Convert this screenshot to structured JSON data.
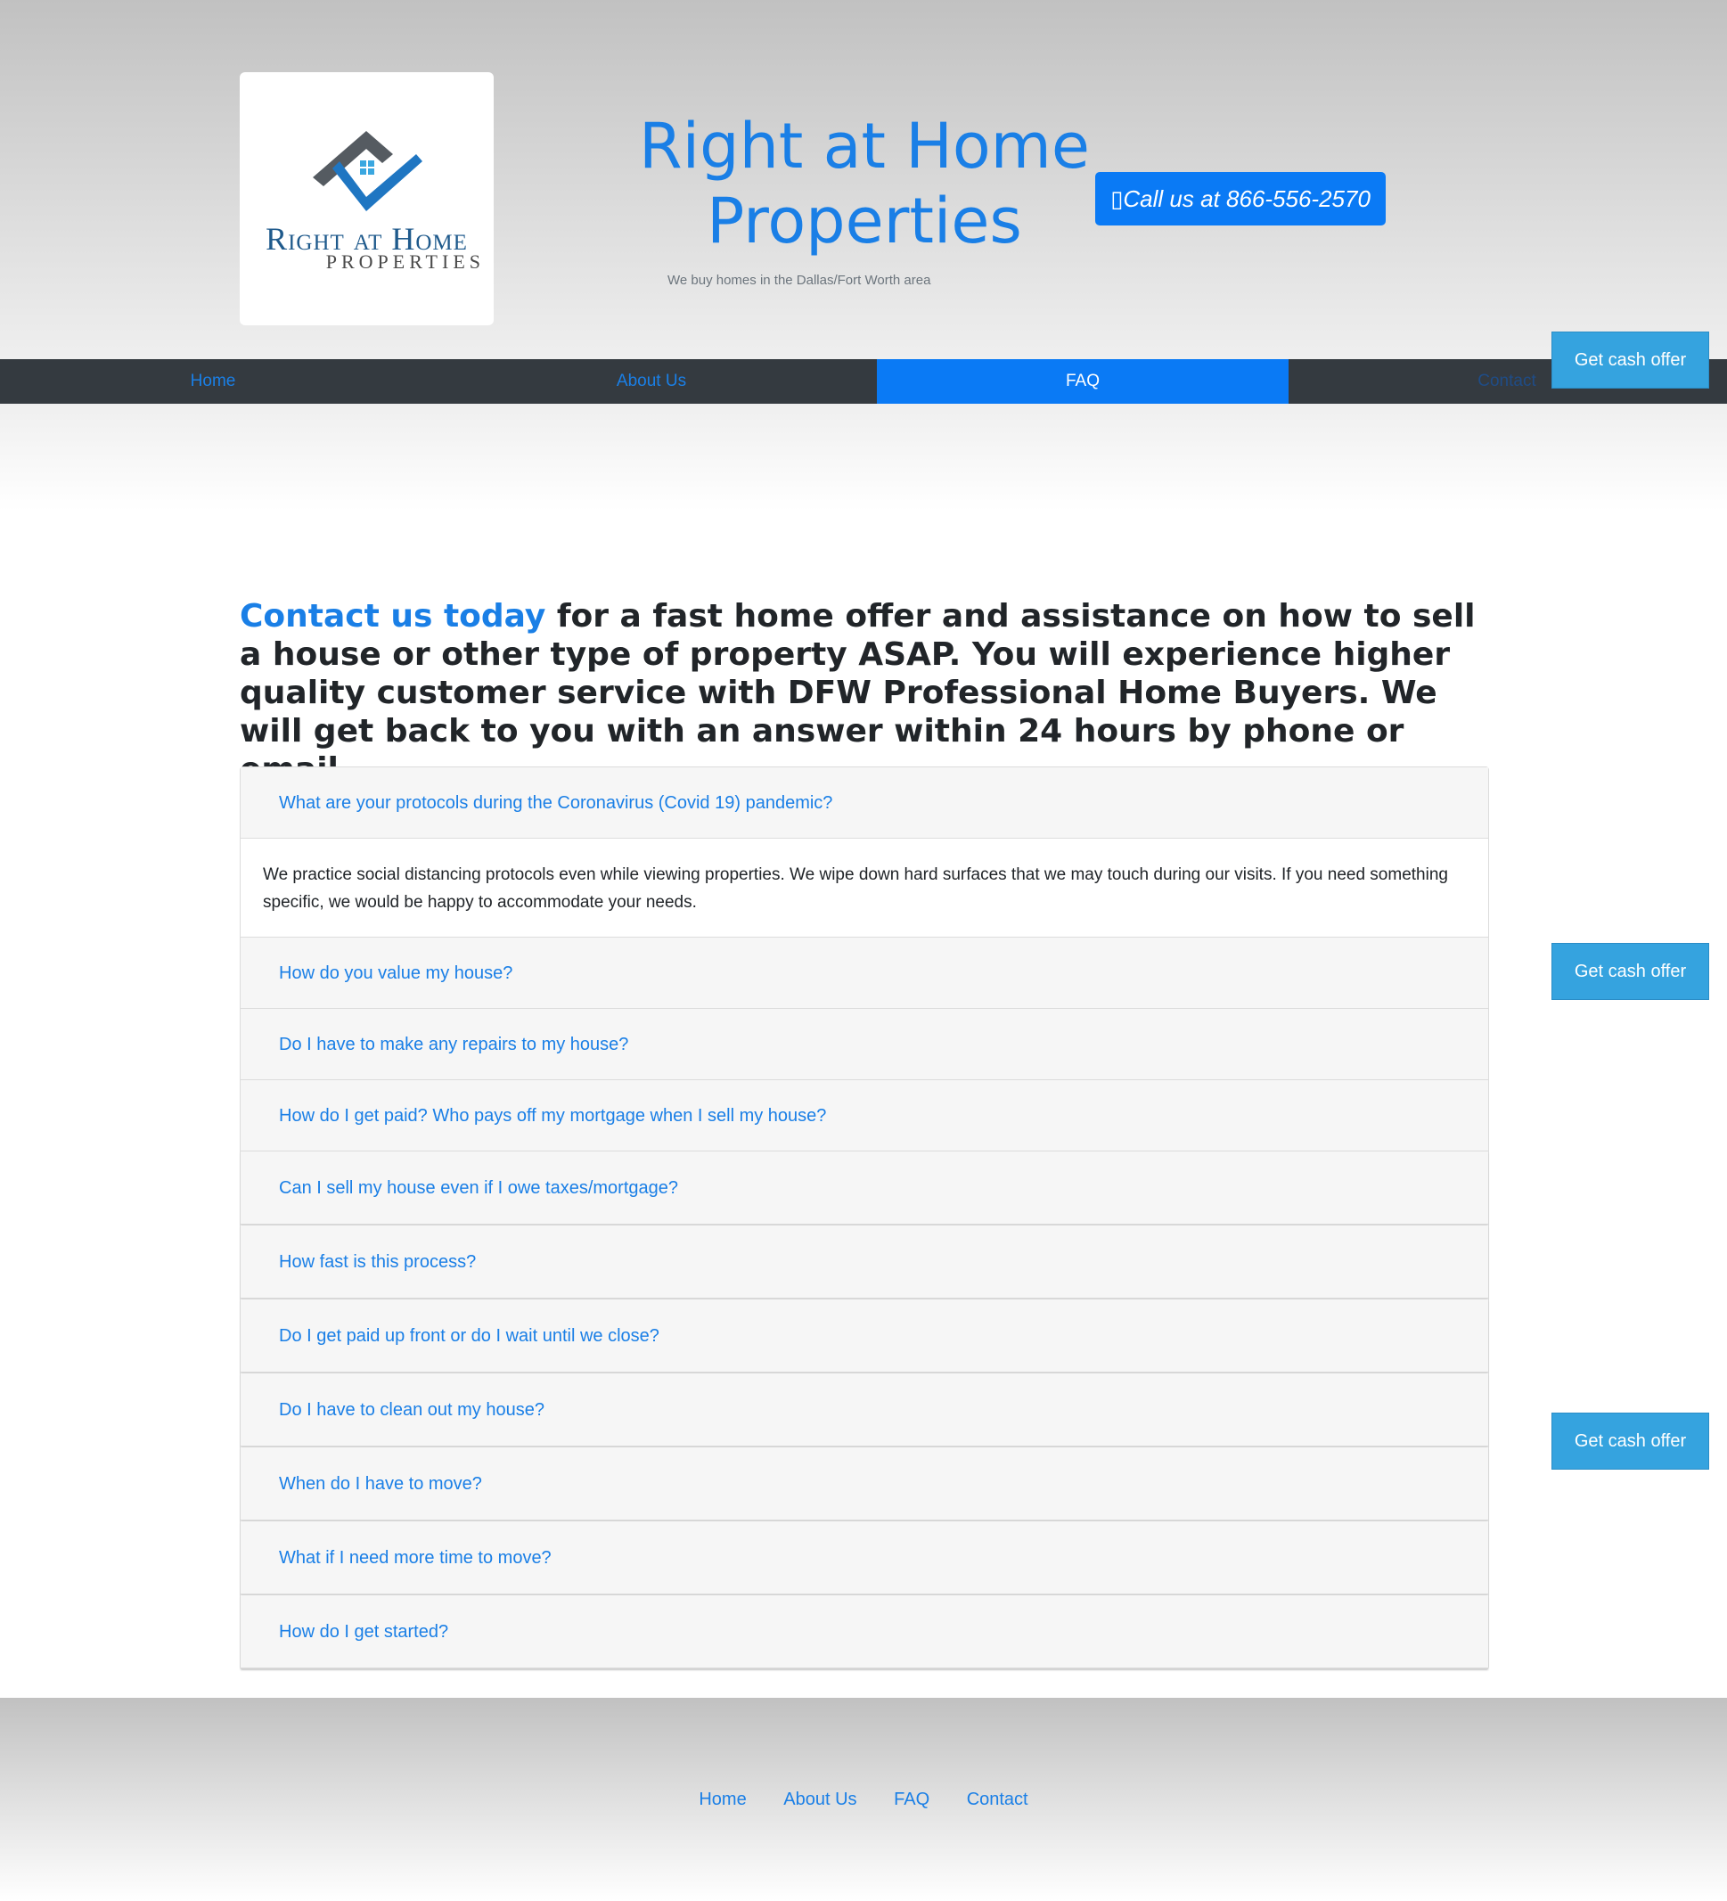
{
  "brand": {
    "logo_line1": "Right at Home",
    "logo_line2": "PROPERTIES",
    "title": "Right at Home Properties",
    "tagline": "We buy homes in the Dallas/Fort Worth area",
    "call_label": "▯Call us at 866-556-2570"
  },
  "nav": {
    "items": [
      {
        "label": "Home"
      },
      {
        "label": "About Us"
      },
      {
        "label": "FAQ",
        "active": true
      },
      {
        "label": "Contact"
      }
    ]
  },
  "cta": {
    "cash_offer": "Get cash offer"
  },
  "intro": {
    "highlight": "Contact us today",
    "text": " for a fast home offer and assistance on how to sell a house or other type of property ASAP. You will experience higher quality customer service with DFW Professional Home Buyers. We will get back to you with an answer within 24 hours by phone or email."
  },
  "faq": {
    "items": [
      {
        "q": "What are your protocols during the Coronavirus (Covid 19) pandemic?",
        "a": "We practice social distancing protocols even while viewing properties. We wipe down hard surfaces that we may touch during our visits. If you need something specific, we would be happy to accommodate your needs."
      },
      {
        "q": "How do you value my house?"
      },
      {
        "q": "Do I have to make any repairs to my house?"
      },
      {
        "q": "How do I get paid? Who pays off my mortgage when I sell my house?"
      },
      {
        "q": "Can I sell my house even if I owe taxes/mortgage?"
      },
      {
        "q": "How fast is this process?"
      },
      {
        "q": "Do I get paid up front or do I wait until we close?"
      },
      {
        "q": "Do I have to clean out my house?"
      },
      {
        "q": "When do I have to move?"
      },
      {
        "q": "What if I need more time to move?"
      },
      {
        "q": "How do I get started?"
      }
    ]
  },
  "footer": {
    "links": [
      "Home",
      "About Us",
      "FAQ",
      "Contact"
    ]
  },
  "colors": {
    "accent": "#0a7af5",
    "link": "#1a7fe6",
    "nav_bg": "#343a40",
    "cta": "#35a3df"
  }
}
